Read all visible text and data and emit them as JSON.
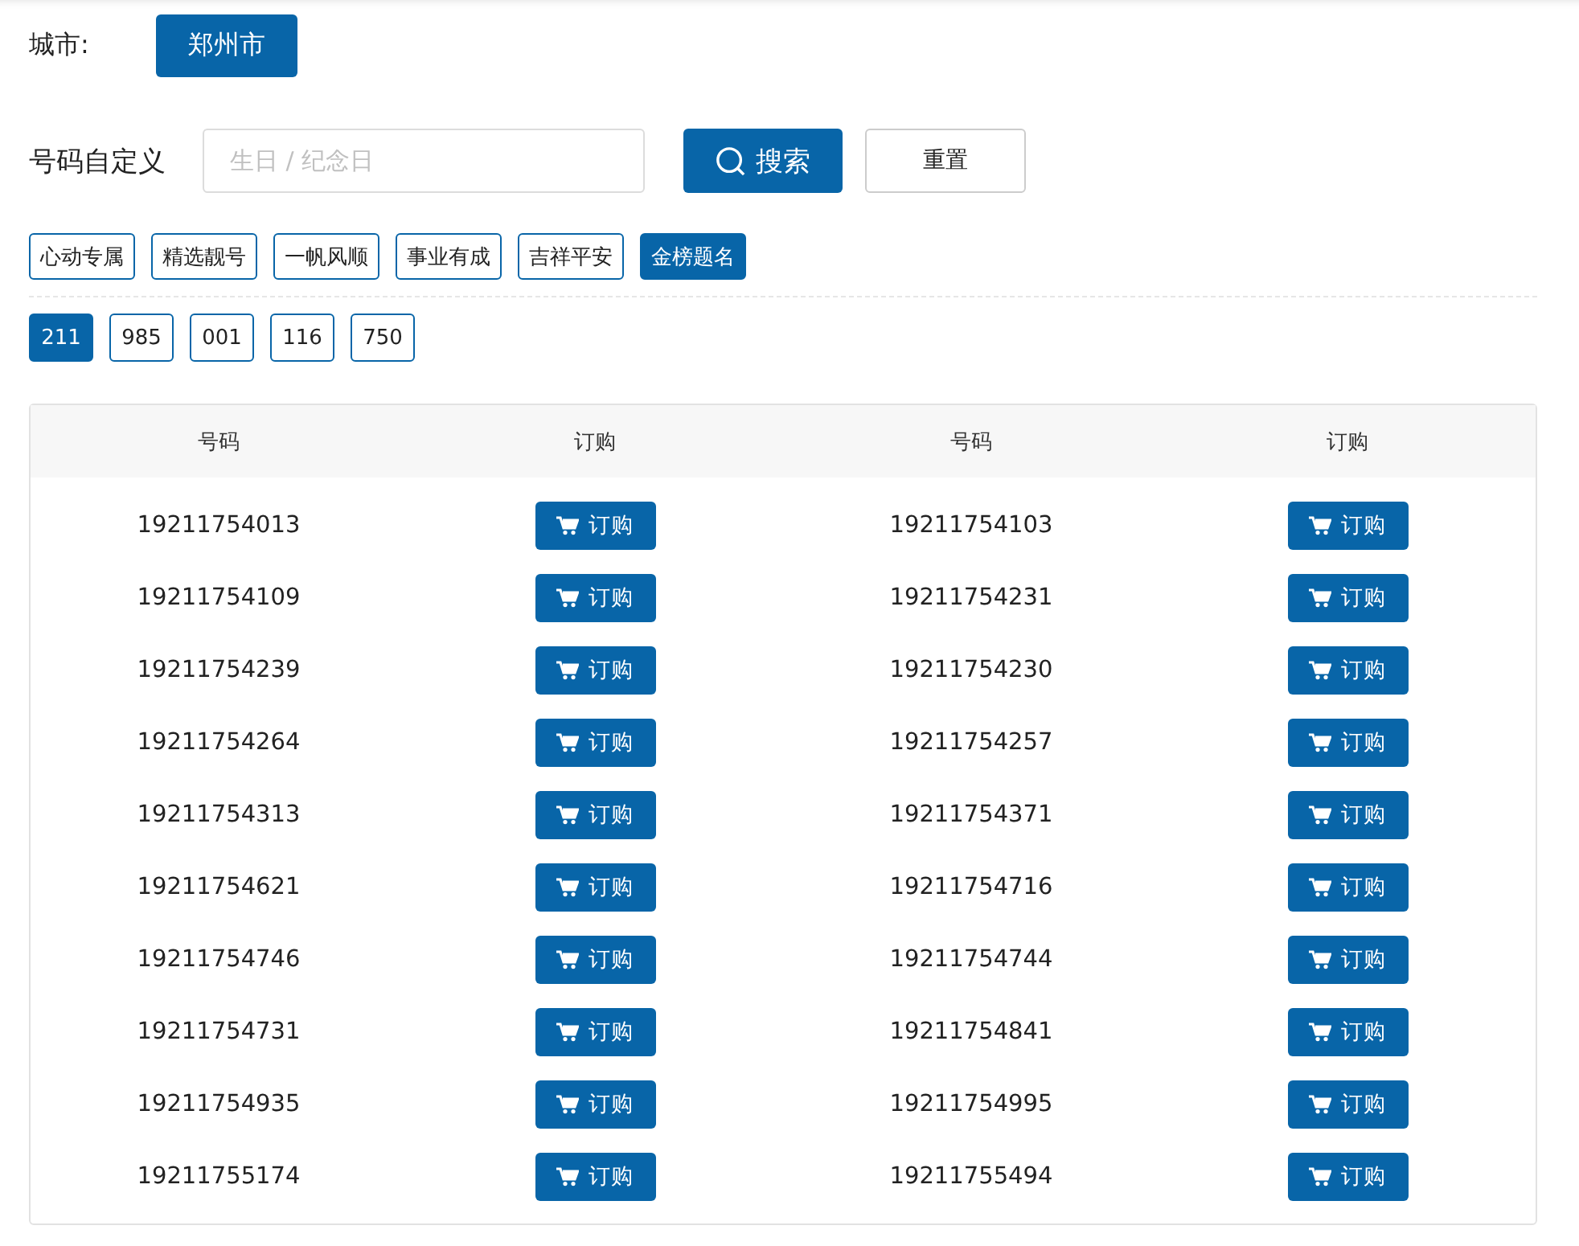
{
  "city": {
    "label": "城市:",
    "value": "郑州市"
  },
  "search": {
    "label": "号码自定义",
    "placeholder": "生日 / 纪念日",
    "search_button": "搜索",
    "reset_button": "重置"
  },
  "categories": [
    {
      "label": "心动专属",
      "selected": false
    },
    {
      "label": "精选靓号",
      "selected": false
    },
    {
      "label": "一帆风顺",
      "selected": false
    },
    {
      "label": "事业有成",
      "selected": false
    },
    {
      "label": "吉祥平安",
      "selected": false
    },
    {
      "label": "金榜题名",
      "selected": true
    }
  ],
  "patterns": [
    {
      "label": "211",
      "selected": true
    },
    {
      "label": "985",
      "selected": false
    },
    {
      "label": "001",
      "selected": false
    },
    {
      "label": "116",
      "selected": false
    },
    {
      "label": "750",
      "selected": false
    }
  ],
  "table": {
    "columns": [
      "号码",
      "订购",
      "号码",
      "订购"
    ],
    "rows": [
      {
        "number_1": "19211754013",
        "order_1": "订购",
        "number_2": "19211754103",
        "order_2": "订购"
      },
      {
        "number_1": "19211754109",
        "order_1": "订购",
        "number_2": "19211754231",
        "order_2": "订购"
      },
      {
        "number_1": "19211754239",
        "order_1": "订购",
        "number_2": "19211754230",
        "order_2": "订购"
      },
      {
        "number_1": "19211754264",
        "order_1": "订购",
        "number_2": "19211754257",
        "order_2": "订购"
      },
      {
        "number_1": "19211754313",
        "order_1": "订购",
        "number_2": "19211754371",
        "order_2": "订购"
      },
      {
        "number_1": "19211754621",
        "order_1": "订购",
        "number_2": "19211754716",
        "order_2": "订购"
      },
      {
        "number_1": "19211754746",
        "order_1": "订购",
        "number_2": "19211754744",
        "order_2": "订购"
      },
      {
        "number_1": "19211754731",
        "order_1": "订购",
        "number_2": "19211754841",
        "order_2": "订购"
      },
      {
        "number_1": "19211754935",
        "order_1": "订购",
        "number_2": "19211754995",
        "order_2": "订购"
      },
      {
        "number_1": "19211755174",
        "order_1": "订购",
        "number_2": "19211755494",
        "order_2": "订购"
      }
    ]
  }
}
